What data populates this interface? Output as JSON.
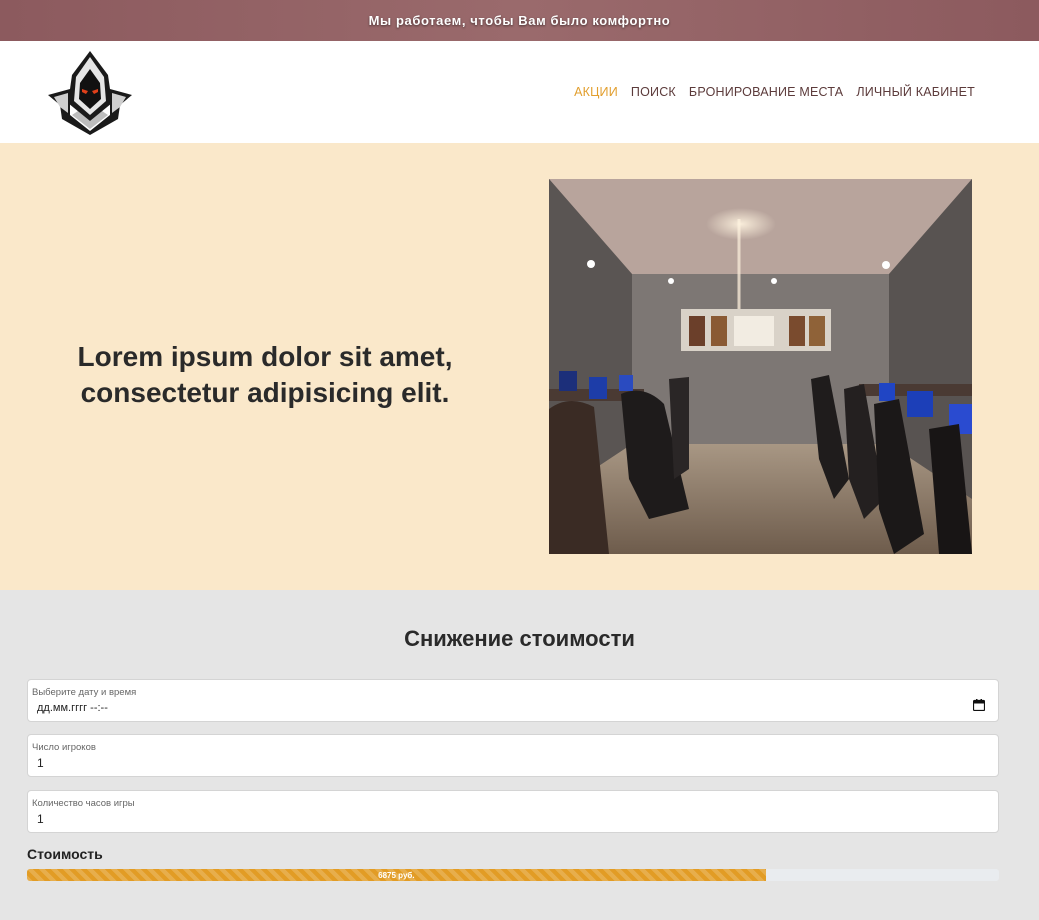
{
  "topbar": {
    "text": "Мы работаем, чтобы Вам было комфортно"
  },
  "header": {
    "logo_icon": "hooded-gamer-logo-icon",
    "nav": [
      {
        "label": "АКЦИИ",
        "active": true
      },
      {
        "label": "ПОИСК",
        "active": false
      },
      {
        "label": "БРОНИРОВАНИЕ МЕСТА",
        "active": false
      },
      {
        "label": "ЛИЧНЫЙ КАБИНЕТ",
        "active": false
      }
    ]
  },
  "hero": {
    "heading_line1": "Lorem ipsum dolor sit amet,",
    "heading_line2": "consectetur adipisicing elit.",
    "image_icon": "gaming-club-room-photo"
  },
  "calculator": {
    "title": "Снижение стоимости",
    "datetime": {
      "label": "Выберите дату и время",
      "value": "дд.мм.гггг --:--"
    },
    "players": {
      "label": "Число игроков",
      "value": "1"
    },
    "hours": {
      "label": "Количество часов игры",
      "value": "1"
    },
    "cost_label": "Стоимость",
    "progress": {
      "text": "6875 руб.",
      "fraction": 0.76
    }
  },
  "colors": {
    "topbar": "#8c5a5e",
    "nav_active": "#e29f2f",
    "nav": "#5c3b3b",
    "hero_bg": "#fae8ca",
    "section_bg": "#e5e5e5",
    "progress": "#e29c25"
  }
}
